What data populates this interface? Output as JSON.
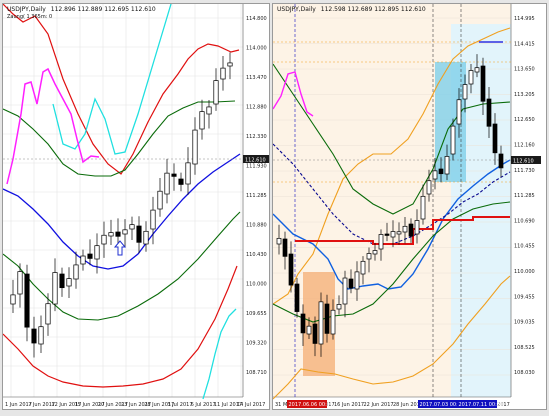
{
  "left_chart": {
    "symbol_title": "USDJPY,Daily",
    "ohlc_text": "112.896 112.889 112.695 112.610",
    "indicator_text": "Zaung( 1.365m: 0",
    "current_price": "112.610",
    "y_labels": [
      "114.800",
      "114.000",
      "113.470",
      "112.880",
      "112.330",
      "111.930",
      "111.285",
      "110.880",
      "110.430",
      "110.000",
      "109.655",
      "109.320",
      "108.710"
    ],
    "x_labels": [
      "1 Jun 2017",
      "7 Jun 2017",
      "12 Jun 2017",
      "15 Jun 2017",
      "20 Jun 2017",
      "23 Jun 2017",
      "28 Jun 2017",
      "3 Jul 2017",
      "6 Jul 2017",
      "11 Jul 2017",
      "14 Jul 2017"
    ],
    "colors": {
      "upper_band": "#e01010",
      "mid_band": "#0a6b0a",
      "base": "#1010e0",
      "cyan": "#20e0e0",
      "magenta": "#ff20ff",
      "candle": "#000000"
    },
    "marker_icon": "up-arrow-icon"
  },
  "right_chart": {
    "symbol_title": "USDJPY,Daily",
    "ohlc_text": "112.598 112.689 112.895 112.610",
    "current_price": "112.610",
    "y_labels": [
      "114.995",
      "114.415",
      "113.650",
      "113.205",
      "112.650",
      "112.160",
      "111.730",
      "111.285",
      "110.690",
      "110.455",
      "110.000",
      "109.455",
      "109.035",
      "108.525",
      "108.030"
    ],
    "x_labels": [
      "31 May 2017",
      "12 Jun 2017",
      "16 Jun 2017",
      "22 Jun 2017",
      "28 Jun 2017",
      "4 Jul 2017",
      "10 Jul 2017",
      "14 Jul 2017"
    ],
    "date_tags": [
      "2017.06.06 00:00",
      "2017.07.03 00:00",
      "2017.07.11 00:00"
    ],
    "colors": {
      "bands": "#f0a020",
      "ma_blue": "#1060e0",
      "ma_navy": "#0a0a90",
      "ma_green": "#0a6b0a",
      "red_line": "#e01010",
      "magenta": "#ff20ff",
      "box_orange": "#f5b27a",
      "box_cyan": "#7fd0ea",
      "bg_tint": "#fdf3e6"
    }
  }
}
